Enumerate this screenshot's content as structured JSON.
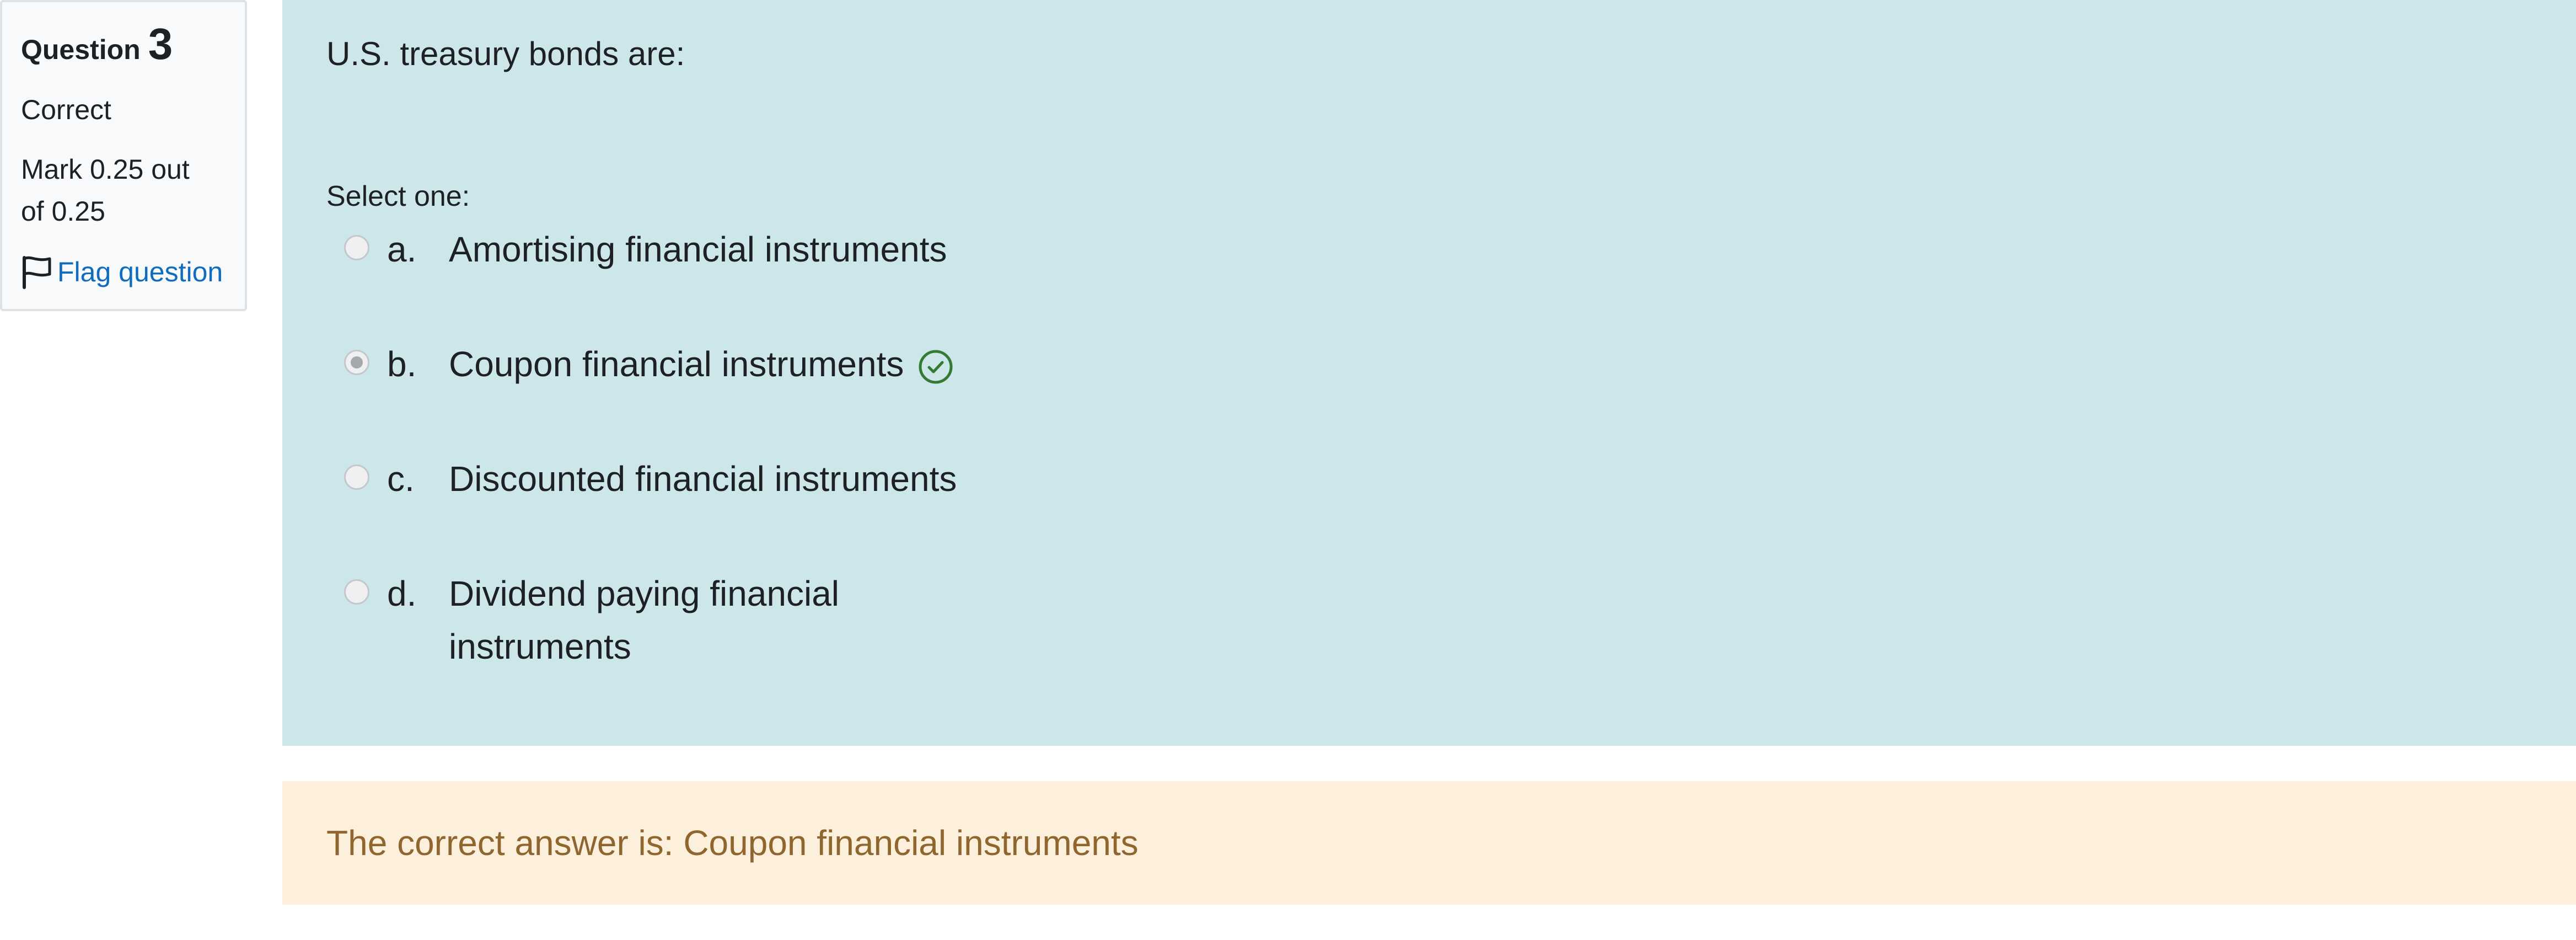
{
  "question_info": {
    "label": "Question",
    "number": "3",
    "state": "Correct",
    "grade": "Mark 0.25 out of 0.25",
    "flag_label": "Flag question"
  },
  "question": {
    "text": "U.S. treasury bonds are:",
    "prompt": "Select one:",
    "options": [
      {
        "letter": "a.",
        "text": "Amortising financial instruments",
        "selected": false
      },
      {
        "letter": "b.",
        "text": "Coupon financial instruments",
        "selected": true,
        "correct": true
      },
      {
        "letter": "c.",
        "text": "Discounted financial instruments",
        "selected": false
      },
      {
        "letter": "d.",
        "text": "Dividend paying financial instruments",
        "selected": false
      }
    ]
  },
  "feedback": {
    "right_answer": "The correct answer is: Coupon financial instruments"
  },
  "colors": {
    "content_bg": "#cce6ea",
    "feedback_bg": "#fcefdc",
    "feedback_text": "#8e662e",
    "link": "#0f6cbf",
    "correct_icon": "#357a32"
  },
  "icons": {
    "flag": "flag-outline-icon",
    "correct": "check-circle-icon"
  }
}
